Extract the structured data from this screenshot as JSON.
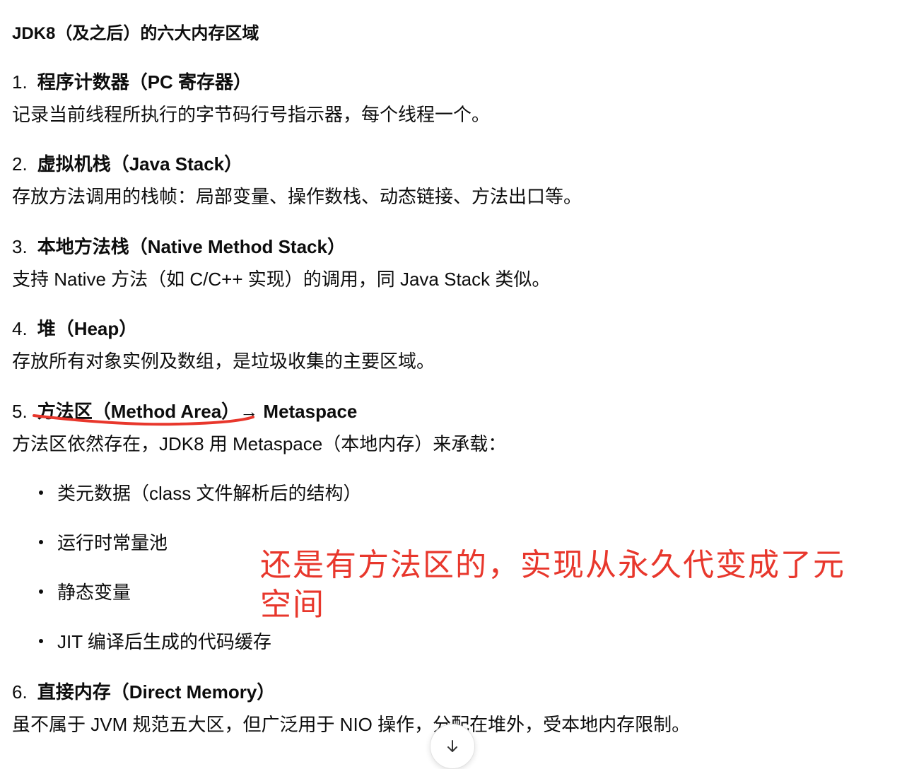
{
  "title": "JDK8（及之后）的六大内存区域",
  "sections": [
    {
      "num": "1.",
      "heading": "程序计数器（PC 寄存器）",
      "desc": "记录当前线程所执行的字节码行号指示器，每个线程一个。"
    },
    {
      "num": "2.",
      "heading": "虚拟机栈（Java Stack）",
      "desc": "存放方法调用的栈帧：局部变量、操作数栈、动态链接、方法出口等。"
    },
    {
      "num": "3.",
      "heading": "本地方法栈（Native Method Stack）",
      "desc": "支持 Native 方法（如 C/C++ 实现）的调用，同 Java Stack 类似。"
    },
    {
      "num": "4.",
      "heading": "堆（Heap）",
      "desc": "存放所有对象实例及数组，是垃圾收集的主要区域。"
    },
    {
      "num": "5.",
      "heading": "方法区（Method Area）→ Metaspace",
      "desc": "方法区依然存在，JDK8 用 Metaspace（本地内存）来承载：",
      "bullets": [
        "类元数据（class 文件解析后的结构）",
        "运行时常量池",
        "静态变量",
        "JIT 编译后生成的代码缓存"
      ]
    },
    {
      "num": "6.",
      "heading": "直接内存（Direct Memory）",
      "desc": "虽不属于 JVM 规范五大区，但广泛用于 NIO 操作，分配在堆外，受本地内存限制。"
    }
  ],
  "annotation": "还是有方法区的，实现从永久代变成了元空间",
  "colors": {
    "annotation": "#e8372c",
    "text": "#0d0d0d"
  },
  "icons": {
    "scroll": "arrow-down-icon"
  }
}
